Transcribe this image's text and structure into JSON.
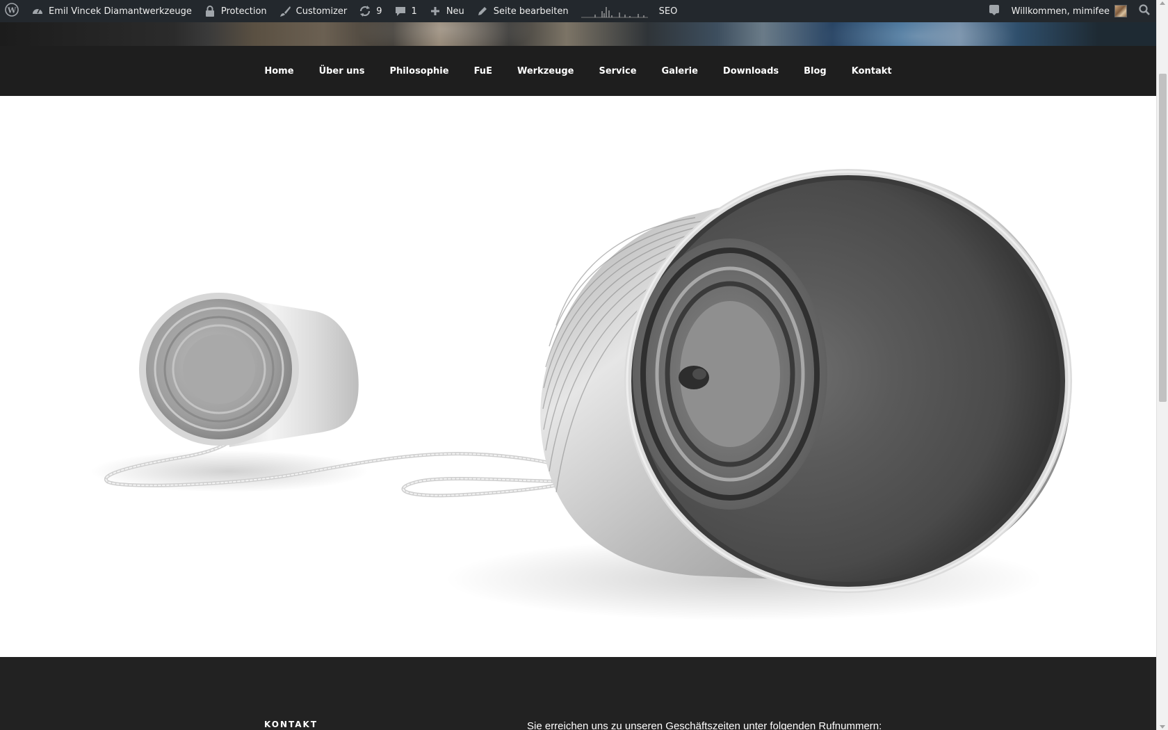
{
  "adminbar": {
    "site_name": "Emil Vincek Diamantwerkzeuge",
    "protection": "Protection",
    "customizer": "Customizer",
    "updates_count": "9",
    "comments_count": "1",
    "new_label": "Neu",
    "edit_page": "Seite bearbeiten",
    "seo": "SEO",
    "welcome": "Willkommen, mimifee",
    "icons": [
      "wordpress-logo-icon",
      "dashboard-icon",
      "lock-icon",
      "brush-icon",
      "refresh-icon",
      "comment-icon",
      "plus-icon",
      "pencil-icon",
      "notification-icon",
      "search-icon"
    ]
  },
  "nav": {
    "items": [
      "Home",
      "Über uns",
      "Philosophie",
      "FuE",
      "Werkzeuge",
      "Service",
      "Galerie",
      "Downloads",
      "Blog",
      "Kontakt"
    ]
  },
  "footer": {
    "heading": "KONTAKT",
    "text": "Sie erreichen uns zu unseren Geschäftszeiten unter folgenden Rufnummern:"
  },
  "colors": {
    "adminbar_bg": "#23282d",
    "nav_bg": "#1e1e1e",
    "footer_bg": "#222222"
  }
}
